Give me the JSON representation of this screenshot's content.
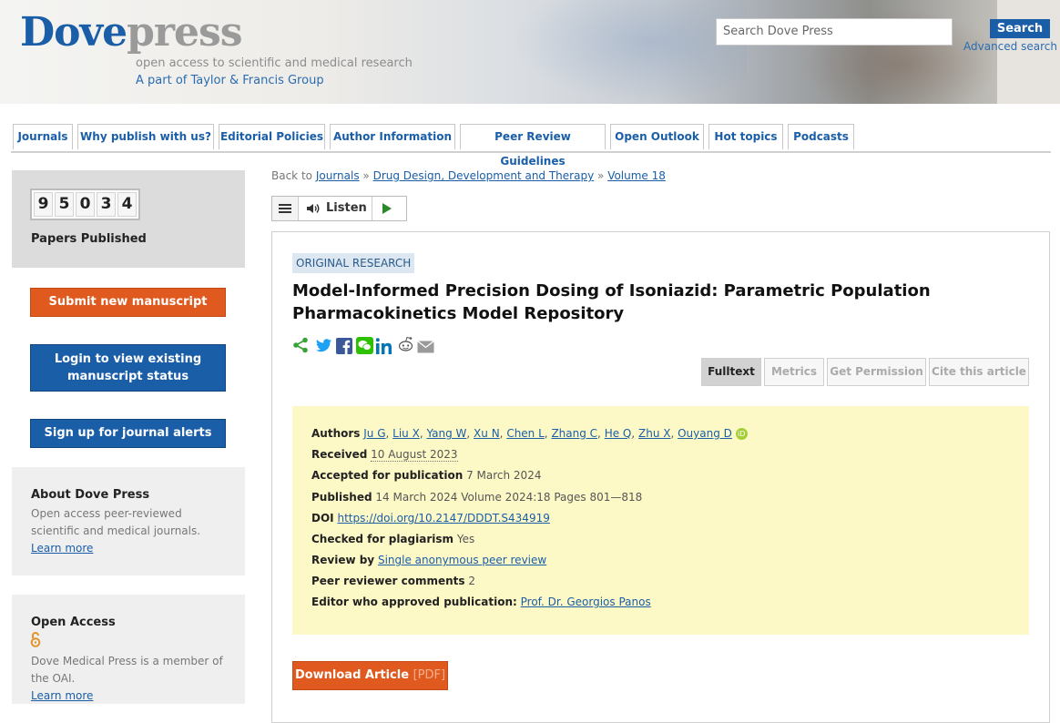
{
  "header": {
    "logo_part1": "Dove",
    "logo_part2": "press",
    "tagline": "open access to scientific and medical research",
    "part_of": "A part of Taylor & Francis Group",
    "search_placeholder": "Search Dove Press",
    "search_button": "Search",
    "advanced_search": "Advanced search"
  },
  "nav": [
    "Journals",
    "Why publish with us?",
    "Editorial Policies",
    "Author Information",
    "Peer Review Guidelines",
    "Open Outlook",
    "Hot topics",
    "Podcasts"
  ],
  "sidebar": {
    "counter_digits": [
      "9",
      "5",
      "0",
      "3",
      "4"
    ],
    "papers_label": "Papers Published",
    "submit_button": "Submit new manuscript",
    "login_button": "Login to view existing manuscript status",
    "signup_button": "Sign up for journal alerts",
    "about": {
      "title": "About Dove Press",
      "text": "Open access peer-reviewed scientific and medical journals.",
      "link": "Learn more"
    },
    "open_access": {
      "title": "Open Access",
      "text": "Dove Medical Press is a member of the OAI.",
      "link": "Learn more"
    }
  },
  "breadcrumb": {
    "prefix": "Back to",
    "journals": "Journals",
    "journal": "Drug Design, Development and Therapy",
    "volume": "Volume 18",
    "sep": "»"
  },
  "listen": {
    "label": "Listen"
  },
  "article": {
    "type": "ORIGINAL RESEARCH",
    "title": "Model-Informed Precision Dosing of Isoniazid: Parametric Population Pharmacokinetics Model Repository",
    "tabs": [
      "Fulltext",
      "Metrics",
      "Get Permission",
      "Cite this article"
    ],
    "authors_label": "Authors",
    "authors": [
      "Ju G",
      "Liu X",
      "Yang W",
      "Xu N",
      "Chen L",
      "Zhang C",
      "He Q",
      "Zhu X",
      "Ouyang D"
    ],
    "received_label": "Received",
    "received": "10 August 2023",
    "accepted_label": "Accepted for publication",
    "accepted": "7 March 2024",
    "published_label": "Published",
    "published": "14 March 2024 Volume 2024:18 Pages 801—818",
    "doi_label": "DOI",
    "doi": "https://doi.org/10.2147/DDDT.S434919",
    "plagiarism_label": "Checked for plagiarism",
    "plagiarism": "Yes",
    "review_label": "Review by",
    "review": "Single anonymous peer review",
    "comments_label": "Peer reviewer comments",
    "comments": "2",
    "editor_label": "Editor who approved publication:",
    "editor": "Prof. Dr. Georgios Panos",
    "download": "Download Article",
    "download_pdf": "[PDF]"
  }
}
